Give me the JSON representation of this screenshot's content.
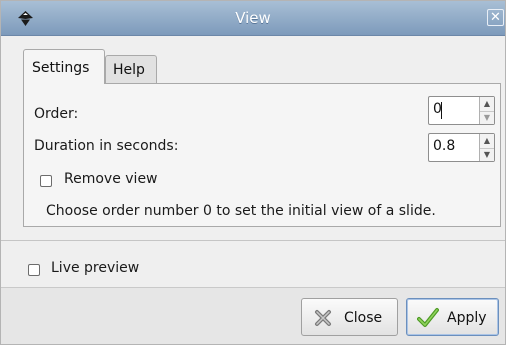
{
  "window": {
    "title": "View",
    "close_glyph": "✕"
  },
  "tabs": [
    {
      "label": "Settings",
      "active": true
    },
    {
      "label": "Help",
      "active": false
    }
  ],
  "settings": {
    "order": {
      "label": "Order:",
      "value": "0"
    },
    "duration": {
      "label": "Duration in seconds:",
      "value": "0.8"
    },
    "remove_view": {
      "label": "Remove view",
      "checked": false
    },
    "hint": "Choose order number 0 to set the initial view of a slide."
  },
  "live_preview": {
    "label": "Live preview",
    "checked": false
  },
  "buttons": {
    "close": {
      "label": "Close",
      "icon": "close-x-icon"
    },
    "apply": {
      "label": "Apply",
      "icon": "checkmark-icon"
    }
  },
  "colors": {
    "titlebar": "#8fa9c8",
    "background": "#efefef",
    "checkmark": "#6cbf3a"
  }
}
